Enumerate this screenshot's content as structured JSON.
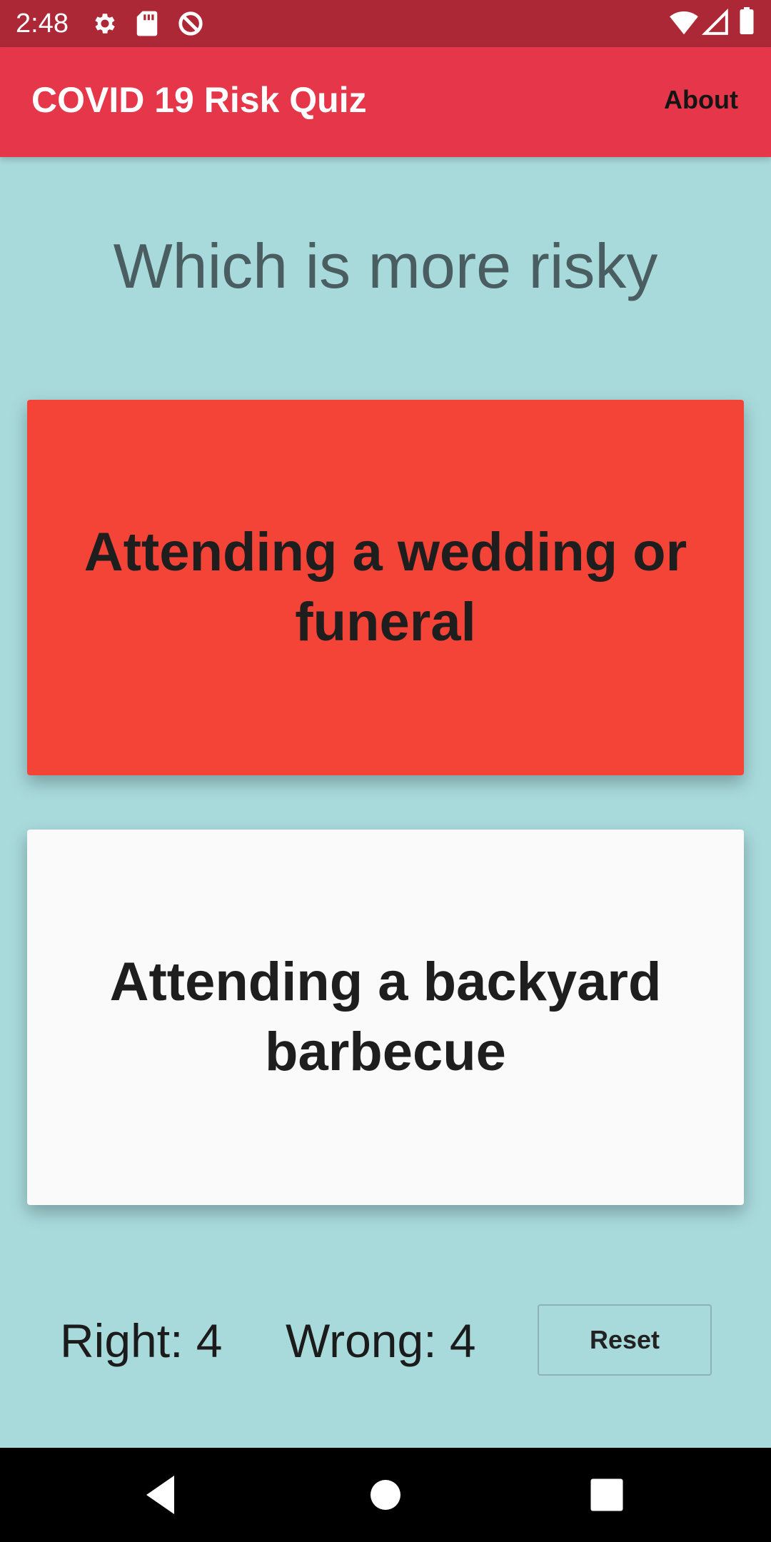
{
  "status_bar": {
    "time": "2:48",
    "icons": [
      "gear-icon",
      "sd-card-icon",
      "no-sync-icon",
      "wifi-icon",
      "signal-icon",
      "battery-icon"
    ]
  },
  "app_bar": {
    "title": "COVID 19 Risk Quiz",
    "about_label": "About"
  },
  "quiz": {
    "question": "Which is more risky",
    "option_a": "Attending a wedding or funeral",
    "option_b": "Attending a backyard barbecue"
  },
  "score": {
    "right": "Right: 4",
    "wrong": "Wrong: 4",
    "reset_label": "Reset"
  },
  "nav": {
    "icons": [
      "back-icon",
      "home-icon",
      "recents-icon"
    ]
  },
  "colors": {
    "status_bar": "#ad2836",
    "app_bar": "#e63649",
    "background": "#a8dadc",
    "option_a": "#f44337",
    "option_b": "#fafafa"
  }
}
